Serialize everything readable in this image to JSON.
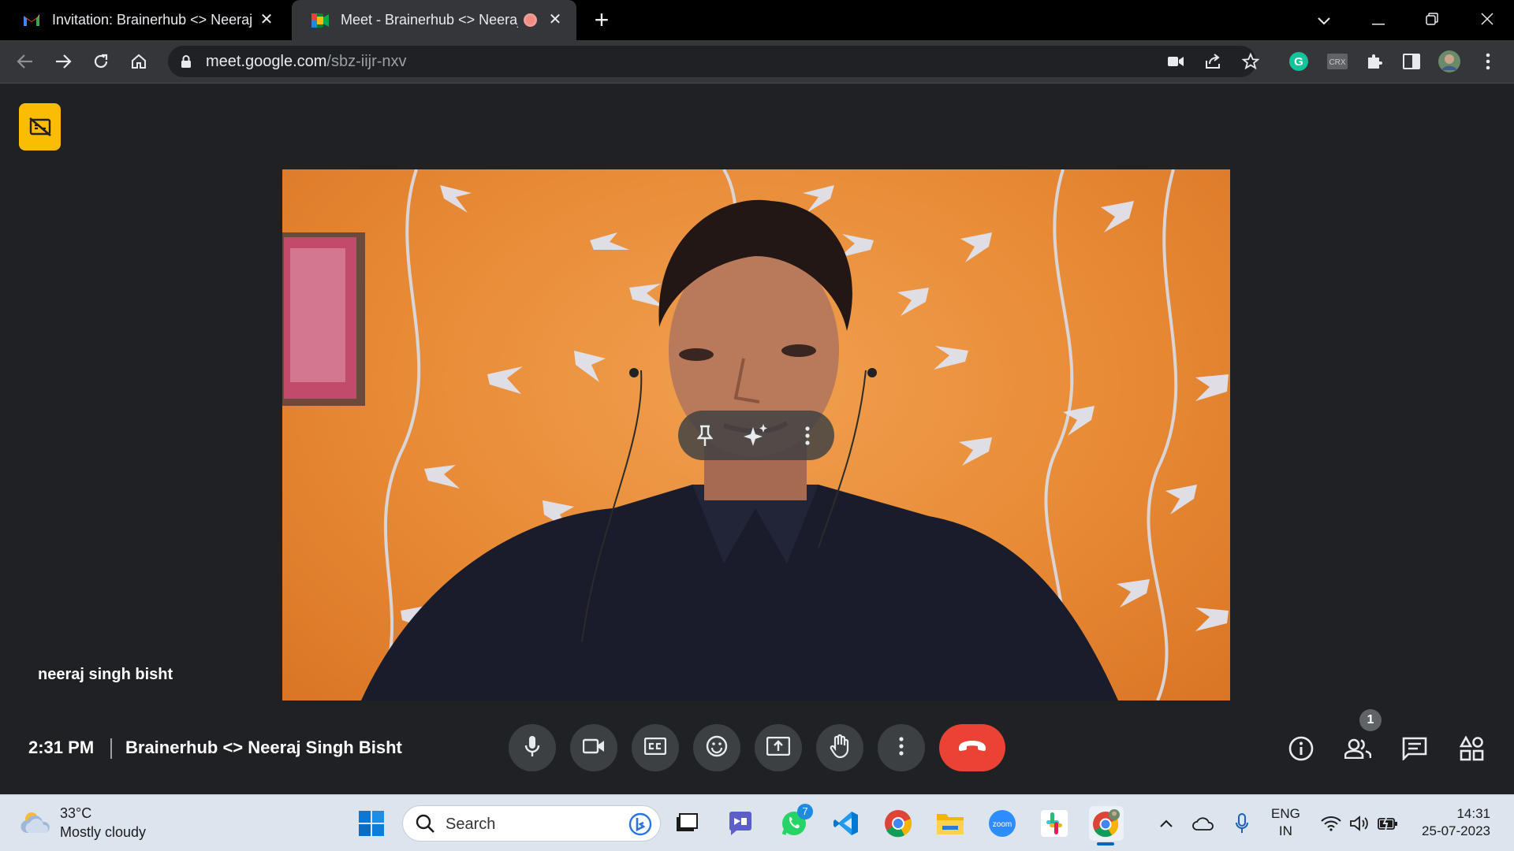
{
  "browser": {
    "tabs": [
      {
        "title": "Invitation: Brainerhub <> Neeraj",
        "favicon": "gmail-icon",
        "active": false
      },
      {
        "title": "Meet - Brainerhub <> Neeraj",
        "favicon": "meet-icon",
        "active": true,
        "recording": true
      }
    ],
    "url_host": "meet.google.com",
    "url_path": "/sbz-iijr-nxv",
    "extension_label": "CRX"
  },
  "meet": {
    "participant_name": "neeraj singh bisht",
    "time": "2:31 PM",
    "meeting_title": "Brainerhub <> Neeraj Singh Bisht",
    "participant_count": "1",
    "colors": {
      "end_call": "#ea4335",
      "badge": "#fbbc04",
      "control_bg": "#3c4043"
    }
  },
  "taskbar": {
    "weather_temp": "33°C",
    "weather_desc": "Mostly cloudy",
    "search_placeholder": "Search",
    "whatsapp_badge": "7",
    "zoom_label": "zoom",
    "lang_top": "ENG",
    "lang_bottom": "IN",
    "clock_time": "14:31",
    "clock_date": "25-07-2023"
  }
}
